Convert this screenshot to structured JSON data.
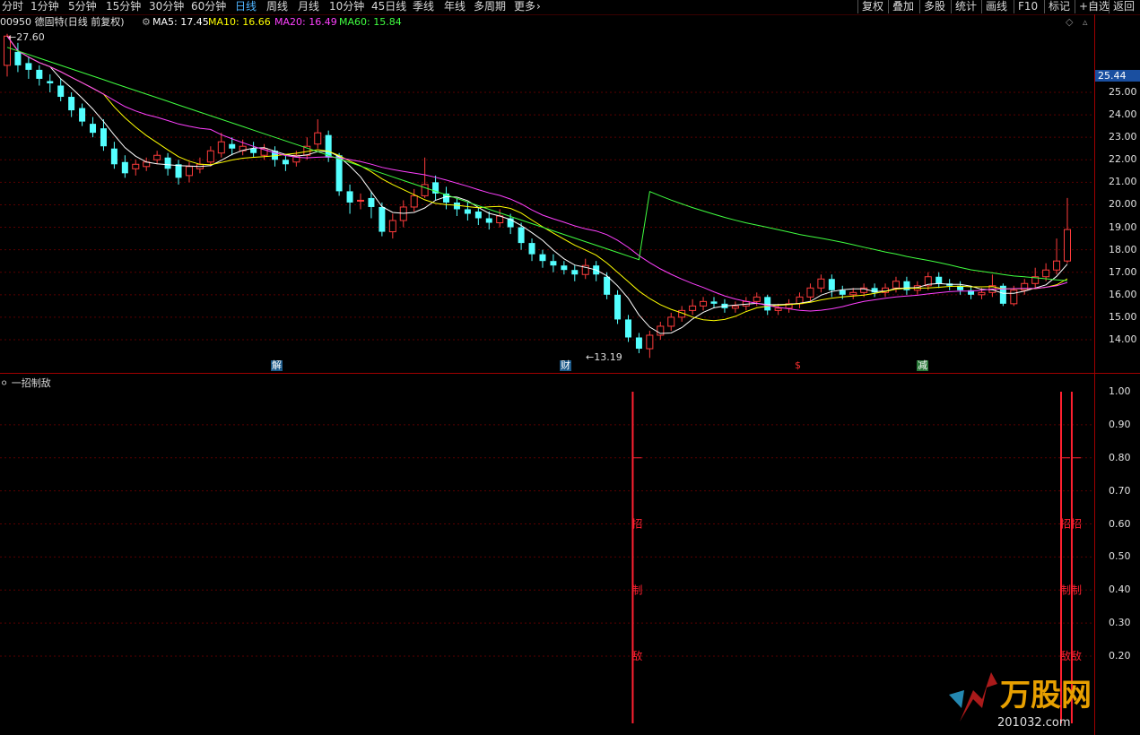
{
  "toolbar": {
    "tabs": [
      "分时",
      "1分钟",
      "5分钟",
      "15分钟",
      "30分钟",
      "60分钟",
      "日线",
      "周线",
      "月线",
      "10分钟",
      "45日线",
      "季线",
      "年线",
      "多周期",
      "更多"
    ],
    "active_tab": "日线",
    "right_buttons": [
      "复权",
      "叠加",
      "多股",
      "统计",
      "画线",
      "F10",
      "标记",
      "+自选",
      "返回"
    ]
  },
  "header": {
    "stock": "00950 德固特(日线 前复权)",
    "ma5_label": "MA5: 17.45",
    "ma10_label": "MA10: 16.66",
    "ma20_label": "MA20: 16.49",
    "ma60_label": "MA60: 15.84"
  },
  "colors": {
    "up": "#ff3c3c",
    "down": "#54ffff",
    "ma5": "#ffffff",
    "ma10": "#ffff00",
    "ma20": "#ff40ff",
    "ma60": "#40ff40",
    "signal": "#ff2030"
  },
  "price_axis": [
    "25.00",
    "24.00",
    "23.00",
    "22.00",
    "21.00",
    "20.00",
    "19.00",
    "18.00",
    "17.00",
    "16.00",
    "15.00",
    "14.00"
  ],
  "current_price": "25.44",
  "annotations": {
    "high": "27.60",
    "low": "13.19"
  },
  "markers": [
    "解",
    "财",
    "$",
    "减"
  ],
  "indicator": {
    "title": "一招制敌",
    "axis": [
      "1.00",
      "0.90",
      "0.80",
      "0.70",
      "0.60",
      "0.50",
      "0.40",
      "0.30",
      "0.20"
    ],
    "signal_chars": [
      "招",
      "制",
      "敌"
    ]
  },
  "watermark": "万股网",
  "watermark_url": "201032.com",
  "chart_data": {
    "type": "candlestick",
    "ylim": [
      13.0,
      28.0
    ],
    "candles": [
      [
        26.2,
        27.5,
        27.6,
        25.7
      ],
      [
        26.8,
        26.2,
        27.2,
        25.9
      ],
      [
        26.3,
        26.0,
        26.6,
        25.6
      ],
      [
        26.0,
        25.6,
        26.2,
        25.3
      ],
      [
        25.5,
        25.4,
        25.8,
        25.0
      ],
      [
        25.3,
        24.8,
        25.6,
        24.6
      ],
      [
        24.8,
        24.2,
        25.0,
        23.9
      ],
      [
        24.3,
        23.7,
        24.5,
        23.5
      ],
      [
        23.6,
        23.2,
        23.9,
        23.0
      ],
      [
        23.4,
        22.6,
        23.8,
        22.4
      ],
      [
        22.5,
        21.8,
        22.8,
        21.6
      ],
      [
        21.9,
        21.4,
        22.2,
        21.2
      ],
      [
        21.6,
        21.8,
        22.0,
        21.3
      ],
      [
        21.7,
        21.9,
        22.1,
        21.5
      ],
      [
        22.0,
        22.2,
        22.4,
        21.8
      ],
      [
        22.1,
        21.6,
        22.3,
        21.3
      ],
      [
        21.8,
        21.2,
        22.0,
        20.9
      ],
      [
        21.3,
        21.7,
        21.9,
        21.0
      ],
      [
        21.6,
        21.8,
        22.1,
        21.4
      ],
      [
        21.9,
        22.4,
        22.6,
        21.7
      ],
      [
        22.3,
        22.8,
        23.2,
        22.1
      ],
      [
        22.7,
        22.5,
        23.0,
        22.2
      ],
      [
        22.4,
        22.6,
        22.9,
        22.2
      ],
      [
        22.5,
        22.3,
        22.8,
        22.1
      ],
      [
        22.2,
        22.5,
        22.7,
        22.0
      ],
      [
        22.4,
        22.0,
        22.6,
        21.7
      ],
      [
        22.0,
        21.8,
        22.2,
        21.5
      ],
      [
        21.9,
        22.2,
        22.4,
        21.7
      ],
      [
        22.2,
        22.6,
        23.0,
        22.0
      ],
      [
        22.7,
        23.2,
        23.8,
        22.5
      ],
      [
        23.1,
        22.1,
        23.3,
        21.9
      ],
      [
        22.2,
        20.6,
        22.3,
        20.4
      ],
      [
        20.6,
        20.1,
        20.9,
        19.6
      ],
      [
        20.2,
        20.2,
        20.5,
        19.8
      ],
      [
        20.3,
        19.9,
        20.6,
        19.4
      ],
      [
        19.9,
        18.8,
        20.1,
        18.6
      ],
      [
        18.8,
        19.3,
        19.6,
        18.5
      ],
      [
        19.3,
        19.9,
        20.2,
        19.0
      ],
      [
        19.9,
        20.4,
        20.7,
        19.7
      ],
      [
        20.4,
        20.9,
        22.1,
        20.3
      ],
      [
        21.0,
        20.5,
        21.3,
        20.2
      ],
      [
        20.5,
        20.1,
        20.8,
        19.8
      ],
      [
        20.1,
        19.8,
        20.3,
        19.5
      ],
      [
        19.8,
        19.6,
        20.1,
        19.3
      ],
      [
        19.7,
        19.4,
        19.9,
        19.1
      ],
      [
        19.4,
        19.2,
        19.7,
        18.9
      ],
      [
        19.2,
        19.5,
        19.8,
        19.0
      ],
      [
        19.4,
        19.0,
        19.6,
        18.7
      ],
      [
        19.0,
        18.3,
        19.2,
        18.0
      ],
      [
        18.3,
        17.8,
        18.5,
        17.5
      ],
      [
        17.8,
        17.5,
        18.0,
        17.2
      ],
      [
        17.5,
        17.3,
        17.8,
        17.0
      ],
      [
        17.3,
        17.1,
        17.5,
        16.9
      ],
      [
        17.1,
        16.9,
        17.3,
        16.6
      ],
      [
        16.9,
        17.3,
        17.6,
        16.7
      ],
      [
        17.3,
        16.9,
        17.5,
        16.6
      ],
      [
        16.8,
        16.0,
        17.0,
        15.8
      ],
      [
        16.0,
        14.9,
        16.2,
        14.7
      ],
      [
        14.9,
        14.1,
        15.1,
        13.9
      ],
      [
        14.1,
        13.6,
        14.3,
        13.4
      ],
      [
        13.6,
        14.2,
        14.4,
        13.19
      ],
      [
        14.2,
        14.6,
        14.8,
        14.0
      ],
      [
        14.6,
        15.0,
        15.2,
        14.4
      ],
      [
        15.0,
        15.3,
        15.5,
        14.8
      ],
      [
        15.3,
        15.5,
        15.8,
        15.1
      ],
      [
        15.5,
        15.7,
        15.9,
        15.3
      ],
      [
        15.7,
        15.6,
        15.9,
        15.4
      ],
      [
        15.6,
        15.4,
        15.8,
        15.2
      ],
      [
        15.4,
        15.5,
        15.7,
        15.2
      ],
      [
        15.5,
        15.7,
        15.9,
        15.3
      ],
      [
        15.7,
        15.9,
        16.1,
        15.5
      ],
      [
        15.9,
        15.3,
        16.0,
        15.1
      ],
      [
        15.3,
        15.4,
        15.6,
        15.1
      ],
      [
        15.4,
        15.6,
        15.8,
        15.2
      ],
      [
        15.6,
        15.9,
        16.1,
        15.4
      ],
      [
        15.9,
        16.3,
        16.5,
        15.7
      ],
      [
        16.3,
        16.7,
        16.9,
        16.1
      ],
      [
        16.7,
        16.2,
        16.9,
        15.9
      ],
      [
        16.2,
        16.0,
        16.4,
        15.8
      ],
      [
        16.0,
        16.1,
        16.3,
        15.8
      ],
      [
        16.1,
        16.3,
        16.5,
        15.9
      ],
      [
        16.3,
        16.1,
        16.5,
        15.9
      ],
      [
        16.1,
        16.3,
        16.5,
        15.9
      ],
      [
        16.3,
        16.6,
        16.8,
        16.1
      ],
      [
        16.6,
        16.2,
        16.8,
        16.0
      ],
      [
        16.2,
        16.4,
        16.6,
        16.0
      ],
      [
        16.4,
        16.8,
        17.0,
        16.2
      ],
      [
        16.8,
        16.5,
        17.0,
        16.3
      ],
      [
        16.5,
        16.4,
        16.7,
        16.2
      ],
      [
        16.4,
        16.2,
        16.6,
        16.0
      ],
      [
        16.2,
        16.0,
        16.4,
        15.8
      ],
      [
        16.0,
        16.1,
        16.3,
        15.8
      ],
      [
        16.1,
        16.4,
        16.9,
        15.9
      ],
      [
        16.4,
        15.6,
        16.5,
        15.5
      ],
      [
        15.6,
        16.2,
        16.4,
        15.5
      ],
      [
        16.2,
        16.5,
        16.7,
        16.0
      ],
      [
        16.5,
        16.8,
        17.2,
        16.3
      ],
      [
        16.8,
        17.1,
        17.4,
        16.6
      ],
      [
        17.1,
        17.5,
        18.5,
        16.9
      ],
      [
        17.5,
        18.9,
        20.3,
        17.4
      ]
    ],
    "signal_positions": [
      59,
      99,
      100
    ]
  }
}
